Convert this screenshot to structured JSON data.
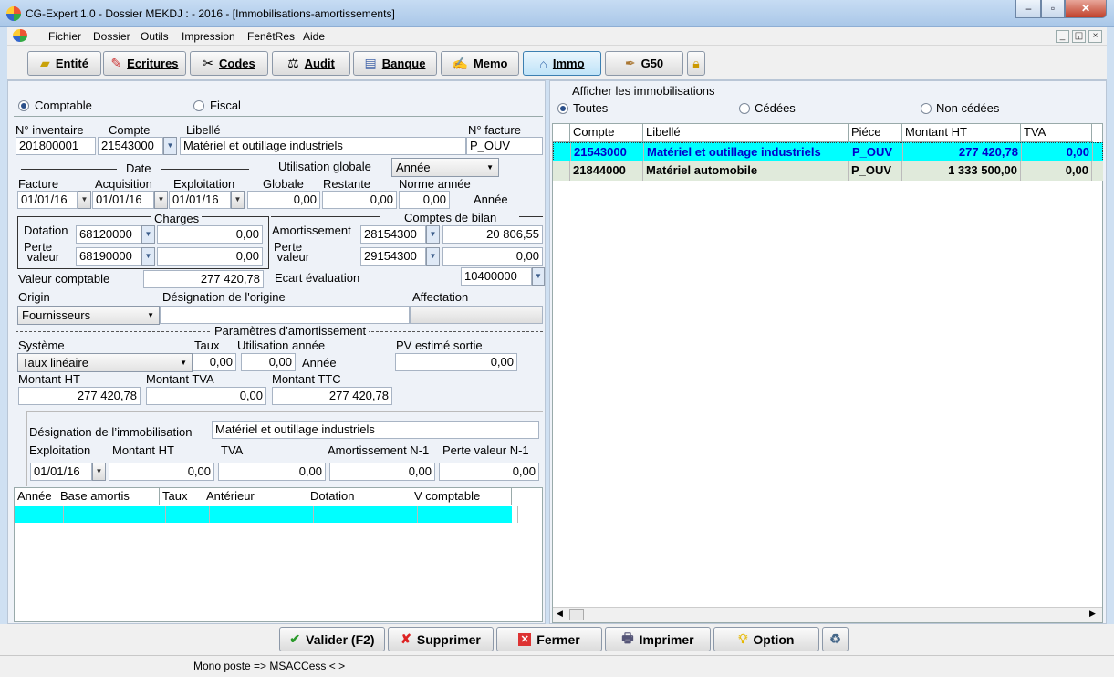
{
  "window": {
    "title": "CG-Expert 1.0 - Dossier MEKDJ :  - 2016 - [Immobilisations-amortissements]"
  },
  "menu": [
    "Fichier",
    "Dossier",
    "Outils",
    "Impression",
    "FenêtRes",
    "Aide"
  ],
  "toolbar": [
    "Entité",
    "Ecritures",
    "Codes",
    "Audit",
    "Banque",
    "Memo",
    "Immo",
    "G50"
  ],
  "mode": {
    "comptable": "Comptable",
    "fiscal": "Fiscal",
    "selected": "Comptable"
  },
  "form": {
    "labels": {
      "inventaire": "N° inventaire",
      "compte": "Compte",
      "libelle": "Libellé",
      "facture_no": "N° facture",
      "date": "Date",
      "utilisation_globale": "Utilisation globale",
      "facture": "Facture",
      "acquisition": "Acquisition",
      "exploitation": "Exploitation",
      "globale": "Globale",
      "restante": "Restante",
      "norme_annee": "Norme année",
      "annee": "Année",
      "charges": "Charges",
      "comptes_bilan": "Comptes de bilan",
      "dotation": "Dotation",
      "perte1": "Perte",
      "perte2": "valeur",
      "amortissement": "Amortissement",
      "valeur_comptable": "Valeur comptable",
      "ecart": "Ecart évaluation",
      "origin": "Origin",
      "designation_origine": "Désignation de l'origine",
      "affectation": "Affectation",
      "params": "Paramètres d’amortissement",
      "systeme": "Système",
      "taux": "Taux",
      "utilisation_annee": "Utilisation année",
      "pv_sortie": "PV estimé sortie",
      "annee2": "Année",
      "montant_ht": "Montant HT",
      "montant_tva": "Montant TVA",
      "montant_ttc": "Montant TTC",
      "designation_immo": "Désignation de l’immobilisation",
      "exploitation2": "Exploitation",
      "montant_ht2": "Montant HT",
      "tva": "TVA",
      "amort_n1": "Amortissement N-1",
      "perte_n1": "Perte valeur  N-1"
    },
    "values": {
      "inventaire": "201800001",
      "compte": "21543000",
      "libelle": "Matériel et outillage industriels",
      "facture_no": "P_OUV",
      "utilisation_globale": "Année",
      "date_facture": "01/01/16",
      "date_acquisition": "01/01/16",
      "date_exploitation": "01/01/16",
      "globale": "0,00",
      "restante": "0,00",
      "norme_annee": "0,00",
      "dotation_compte": "68120000",
      "dotation_montant": "0,00",
      "perte_compte": "68190000",
      "perte_montant": "0,00",
      "amort_compte": "28154300",
      "amort_montant": "20 806,55",
      "perte_bilan_compte": "29154300",
      "perte_bilan_montant": "0,00",
      "valeur_comptable": "277 420,78",
      "ecart": "10400000",
      "origin": "Fournisseurs",
      "designation_origine": "",
      "affectation": "",
      "systeme": "Taux linéaire",
      "taux": "0,00",
      "utilisation_annee": "0,00",
      "pv_sortie": "0,00",
      "montant_ht": "277 420,78",
      "montant_tva": "0,00",
      "montant_ttc": "277 420,78",
      "designation_immo": "Matériel et outillage industriels",
      "exploitation2": "01/01/16",
      "montant_ht2": "0,00",
      "tva": "0,00",
      "amort_n1": "0,00",
      "perte_n1": "0,00"
    }
  },
  "schedule": {
    "columns": [
      "Année",
      "Base amortis",
      "Taux",
      "Antérieur",
      "Dotation",
      "V comptable"
    ]
  },
  "right": {
    "title": "Afficher les immobilisations",
    "filters": [
      "Toutes",
      "Cédées",
      "Non cédées"
    ],
    "selected_filter": "Toutes",
    "columns": [
      "Compte",
      "Libellé",
      "Piéce",
      "Montant HT",
      "TVA"
    ],
    "rows": [
      {
        "compte": "21543000",
        "libelle": "Matériel et outillage industriels",
        "piece": "P_OUV",
        "montant": "277 420,78",
        "tva": "0,00",
        "selected": true
      },
      {
        "compte": "21844000",
        "libelle": "Matériel automobile",
        "piece": "P_OUV",
        "montant": "1 333 500,00",
        "tva": "0,00",
        "selected": false
      }
    ]
  },
  "actions": [
    "Valider (F2)",
    "Supprimer",
    "Fermer",
    "Imprimer",
    "Option"
  ],
  "status": "Mono poste => MSACCess <  >",
  "colors": {
    "selection": "#00ffff",
    "selected_text": "#0000cc",
    "alt_row": "#e0eadb"
  }
}
